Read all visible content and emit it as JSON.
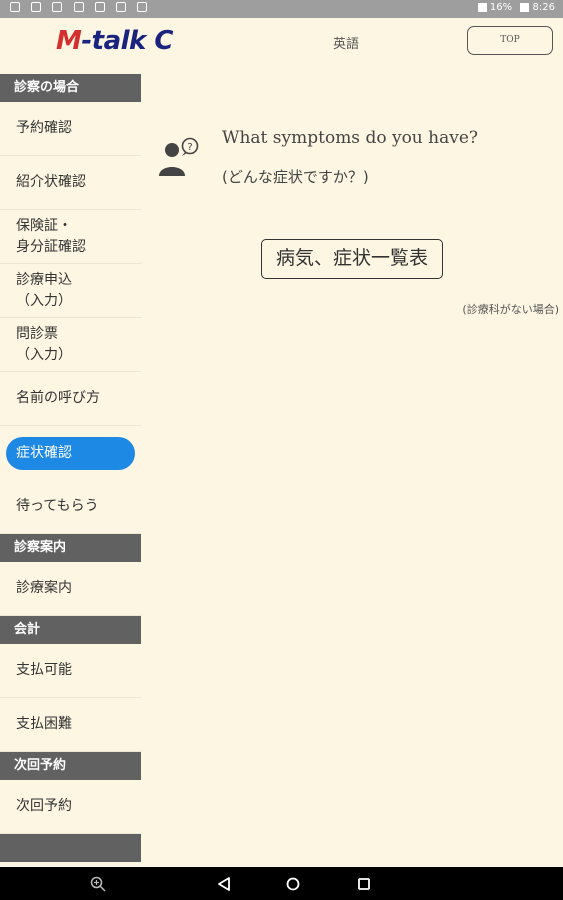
{
  "status_bar": {
    "time": "8:26",
    "battery": "16%"
  },
  "header": {
    "logo_m": "M",
    "logo_rest": "-talk C",
    "language": "英語",
    "top_button": "TOP"
  },
  "sidebar": {
    "sections": [
      {
        "title": "診察の場合",
        "items": [
          "予約確認",
          "紹介状確認",
          "保険証・\n身分証確認",
          "診療申込\n（入力）",
          "問診票\n（入力）",
          "名前の呼び方",
          "症状確認",
          "待ってもらう"
        ]
      },
      {
        "title": "診察案内",
        "items": [
          "診療案内"
        ]
      },
      {
        "title": "会計",
        "items": [
          "支払可能",
          "支払困難"
        ]
      },
      {
        "title": "次回予約",
        "items": [
          "次回予約"
        ]
      }
    ],
    "active_item": "症状確認"
  },
  "main": {
    "question_en": "What symptoms do you have?",
    "question_jp": "(どんな症状ですか？)",
    "list_button": "病気、症状一覧表",
    "note": "(診療科がない場合)"
  },
  "icons": {
    "person": "person-question-icon",
    "zoom": "zoom-icon",
    "back": "back-icon",
    "home": "home-icon",
    "recents": "recents-icon"
  },
  "colors": {
    "background": "#fdf6e3",
    "section_header": "#616161",
    "active_pill": "#1e88e5",
    "logo_blue": "#1a237e",
    "logo_red": "#d32f2f"
  }
}
